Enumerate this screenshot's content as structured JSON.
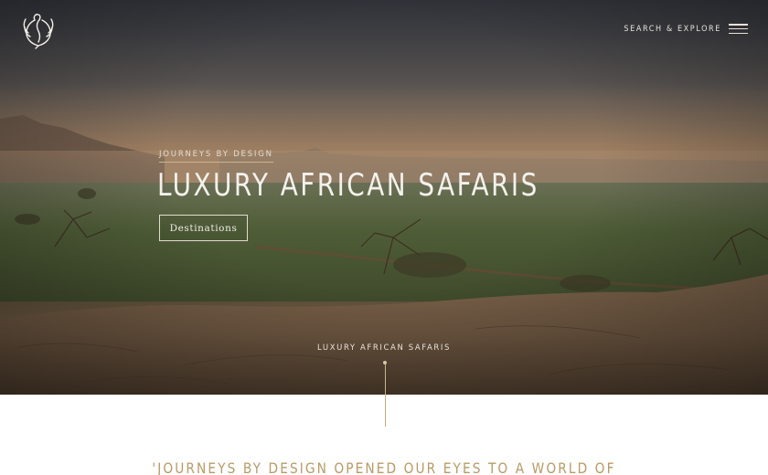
{
  "brand": {
    "logo_icon": "swan-logo-icon",
    "accent_color": "#c9b58f"
  },
  "nav": {
    "search_label": "SEARCH & EXPLORE",
    "menu_icon": "hamburger-menu-icon"
  },
  "hero": {
    "eyebrow": "JOURNEYS BY DESIGN",
    "title": "LUXURY AFRICAN SAFARIS",
    "cta_label": "Destinations",
    "scroll_label": "LUXURY AFRICAN SAFARIS"
  },
  "testimonial": {
    "quote_partial": "'JOURNEYS BY DESIGN OPENED OUR EYES TO A WORLD OF"
  }
}
